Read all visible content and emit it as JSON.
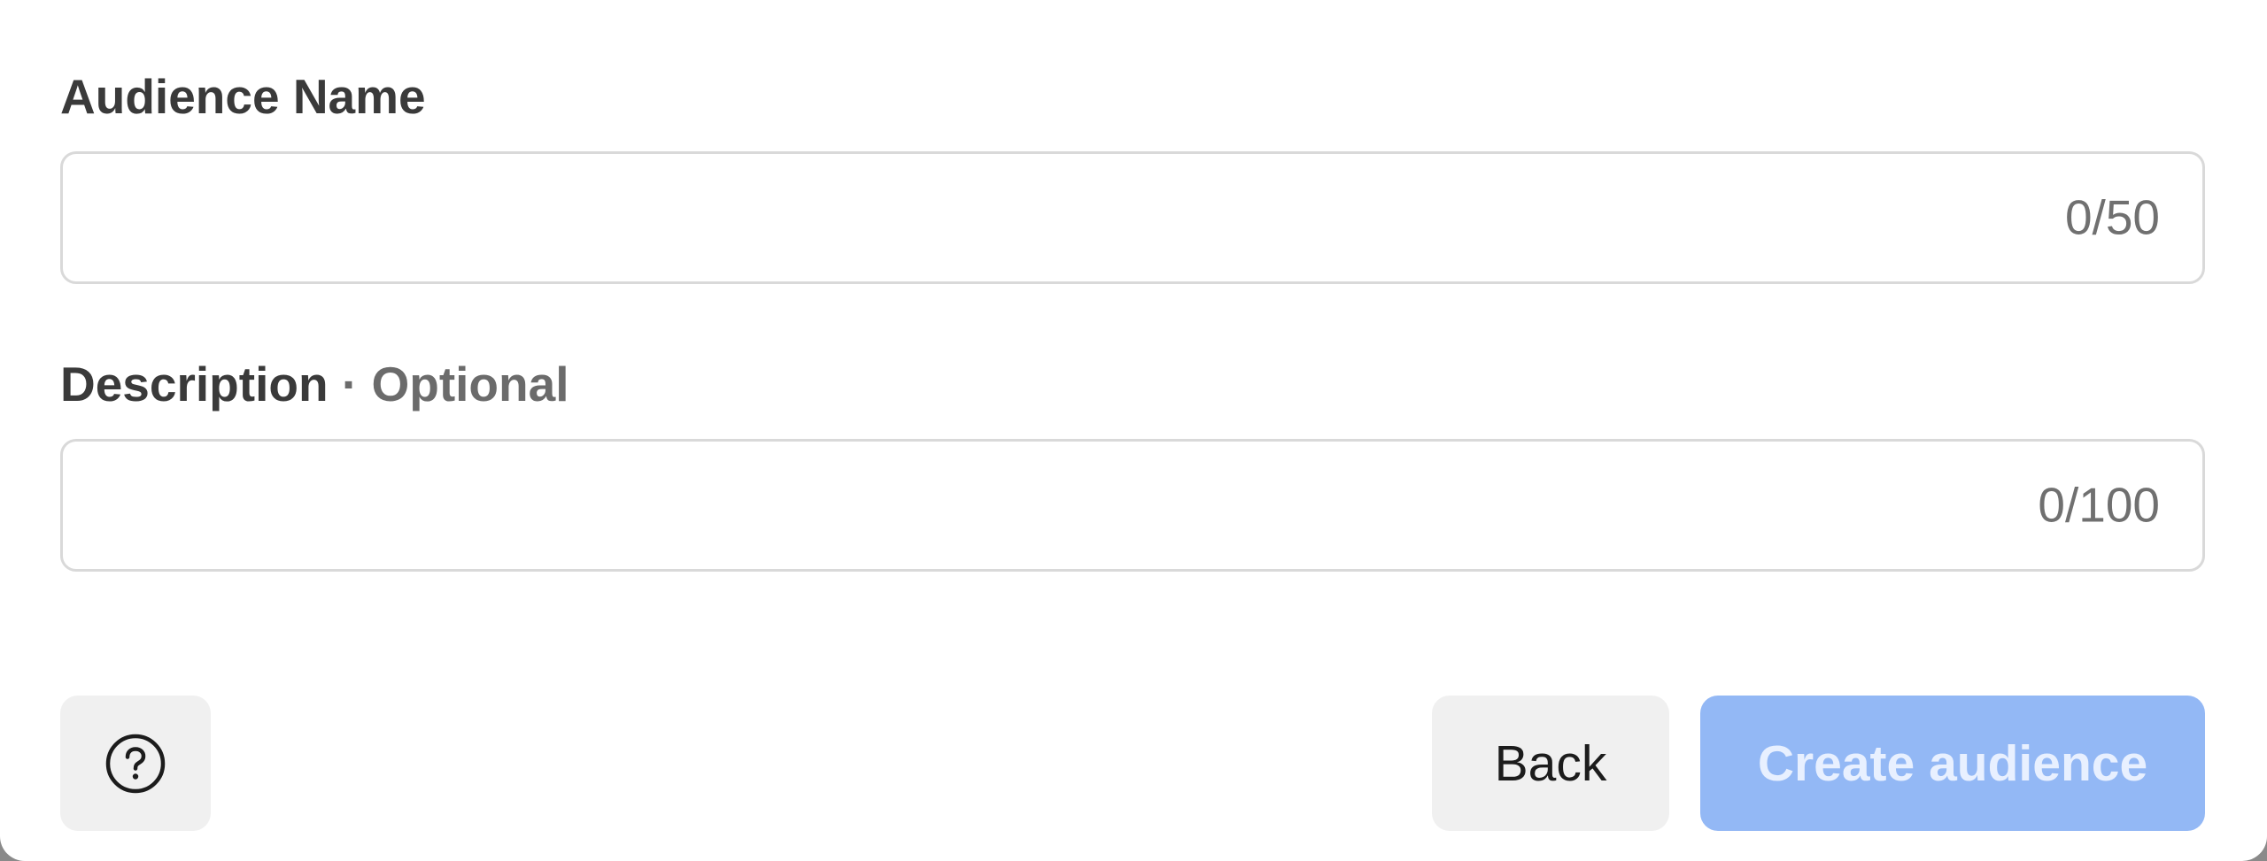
{
  "form": {
    "name_field": {
      "label": "Audience Name",
      "value": "",
      "placeholder": "",
      "counter": "0/50"
    },
    "description_field": {
      "label": "Description",
      "optional_suffix": "· Optional",
      "value": "",
      "placeholder": "",
      "counter": "0/100"
    }
  },
  "footer": {
    "help_icon": "question-circle-icon",
    "back_label": "Back",
    "create_label": "Create audience"
  },
  "colors": {
    "primary_disabled": "#93b8f5",
    "secondary_button": "#f0f0f0",
    "input_border": "#d9d9d9",
    "label_text": "#3a3a3a",
    "muted_text": "#6b6b6b"
  }
}
